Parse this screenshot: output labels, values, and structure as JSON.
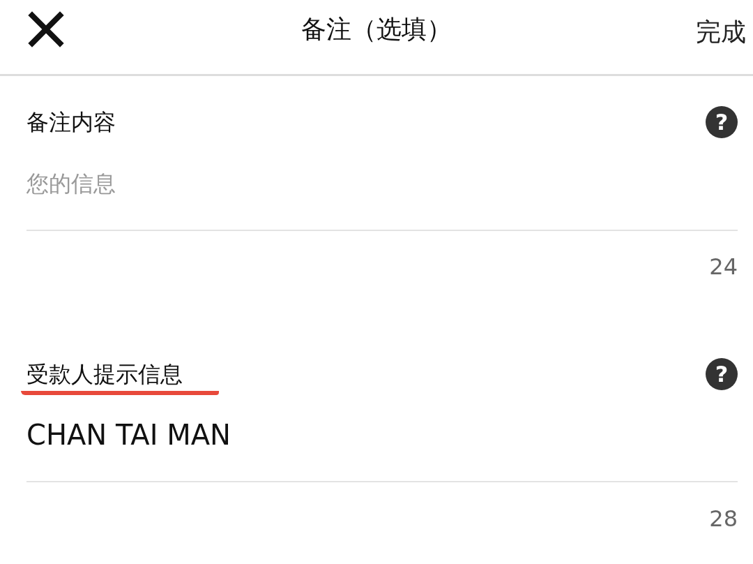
{
  "header": {
    "title": "备注（选填）",
    "done": "完成"
  },
  "fields": [
    {
      "label": "备注内容",
      "help": "?",
      "placeholder": "您的信息",
      "counter": "24",
      "highlighted": false
    },
    {
      "label": "受款人提示信息",
      "help": "?",
      "value": "CHAN TAI MAN",
      "counter": "28",
      "highlighted": true
    }
  ]
}
